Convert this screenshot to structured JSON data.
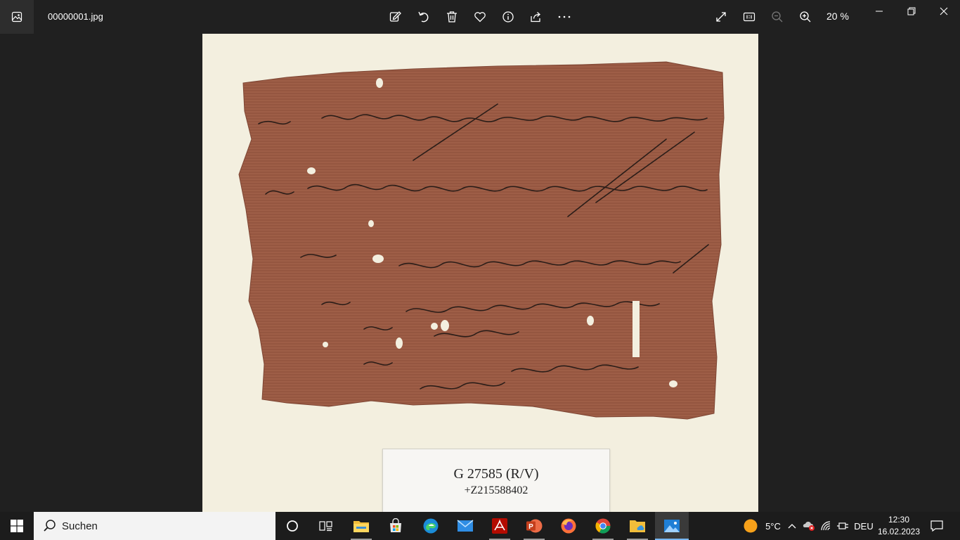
{
  "window": {
    "file_name": "00000001.jpg",
    "zoom_level": "20 %",
    "toolbar": [
      {
        "name": "edit-image-icon",
        "label": "Edit image"
      },
      {
        "name": "rotate-icon",
        "label": "Rotate"
      },
      {
        "name": "delete-icon",
        "label": "Delete"
      },
      {
        "name": "favorite-icon",
        "label": "Favorite"
      },
      {
        "name": "info-icon",
        "label": "File info"
      },
      {
        "name": "share-icon",
        "label": "Share"
      },
      {
        "name": "more-icon",
        "label": "See more"
      }
    ],
    "view_controls": [
      "fullscreen-icon",
      "actual-size-icon",
      "zoom-out-icon",
      "zoom-in-icon"
    ],
    "window_controls": [
      "minimize-icon",
      "restore-icon",
      "close-icon"
    ]
  },
  "photo": {
    "label_line1": "G 27585 (R/V)",
    "label_line2": "+Z215588402",
    "background_color": "#f3efdf",
    "papyrus_color": "#9a5a44"
  },
  "taskbar": {
    "search_placeholder": "Suchen",
    "apps": [
      "cortana-icon",
      "task-view-icon",
      "file-explorer-icon",
      "microsoft-store-icon",
      "edge-icon",
      "mail-icon",
      "acrobat-icon",
      "powerpoint-icon",
      "firefox-icon",
      "chrome-icon",
      "folder-icon",
      "photos-icon"
    ],
    "weather_temp": "5°C",
    "language": "DEU",
    "time": "12:30",
    "date": "16.02.2023"
  },
  "colors": {
    "dark_bg": "#202020",
    "taskbar_bg": "#1c1c1c",
    "accent": "#78b6f0"
  }
}
